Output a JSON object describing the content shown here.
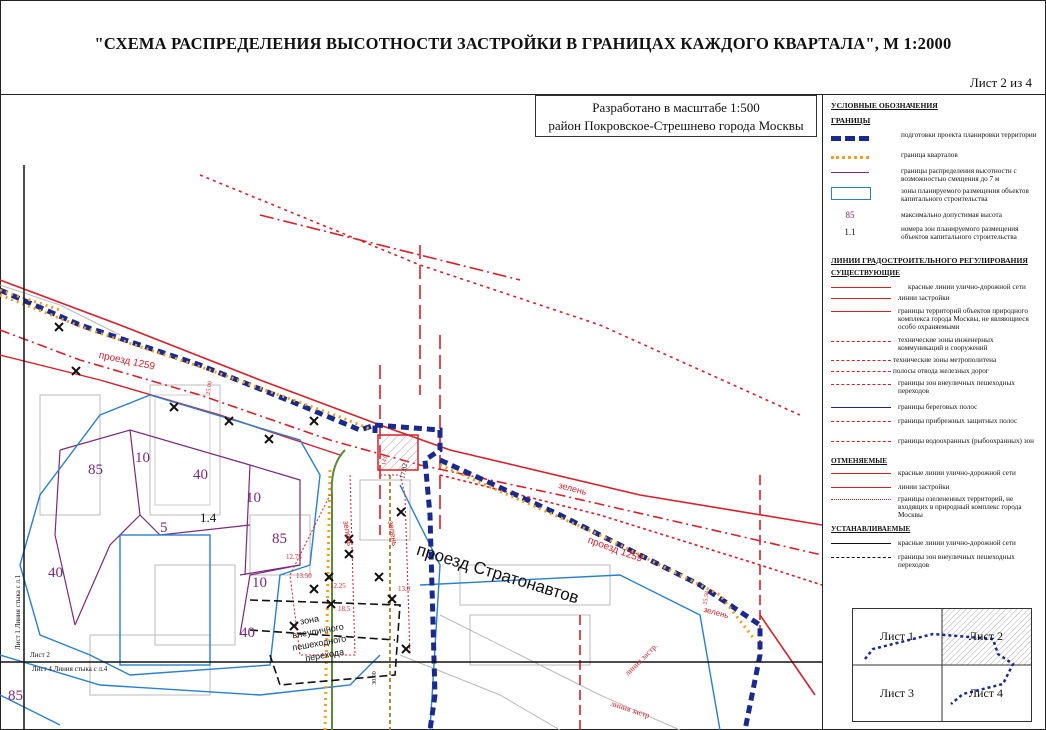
{
  "header": {
    "title": "\"СХЕМА РАСПРЕДЕЛЕНИЯ ВЫСОТНОСТИ ЗАСТРОЙКИ В ГРАНИЦАХ КАЖДОГО КВАРТАЛА\", М 1:2000",
    "sheet": "Лист 2 из 4"
  },
  "scale_box": {
    "line1": "Разработано в масштабе 1:500",
    "line2": "район Покровское-Стрешнево города Москвы"
  },
  "map": {
    "street_main": "проезд Стратонавтов",
    "street_1259_a": "проезд 1259",
    "street_1259_b": "проезд 1259",
    "zelen_a": "зелень",
    "zelen_b": "зелень",
    "zelen_c": "зелень",
    "zelen_d": "зелень",
    "zone_label_1": "зона",
    "zone_label_2": "внеуличного",
    "zone_label_3": "пешеходного",
    "zone_label_4": "перехода",
    "heights": [
      "85",
      "10",
      "40",
      "10",
      "5",
      "85",
      "40",
      "10",
      "40",
      "85"
    ],
    "zone_number": "1.4",
    "small_nums": [
      "25.00",
      "17.82",
      "14.0",
      "12.75",
      "13.50",
      "18.5",
      "12.25",
      "13.0",
      "30.00",
      "25.58"
    ],
    "stitch_1": "Лист 1  Линия стыка с л.1",
    "stitch_2": "Лист 2",
    "stitch_4": "Лист 4  Линия стыка с л.4",
    "liniya_zastr": "линия застр.",
    "liniya_zastr2": "линия застр"
  },
  "legend": {
    "title": "УСЛОВНЫЕ ОБОЗНАЧЕНИЯ",
    "boundaries": "ГРАНИЦЫ",
    "b1": "подготовки проекта планировки территории",
    "b2": "граница кварталов",
    "b3": "границы распределения высотности с возможностью смещения до 7 м",
    "b4": "зоны планируемого размещения объектов капитального строительства",
    "b5_sym": "85",
    "b5": "максимально допустимая высота",
    "b6_sym": "1.1",
    "b6": "номера зон планируемого размещения объектов капитального строительства",
    "lines_title": "ЛИНИИ ГРАДОСТРОИТЕЛЬНОГО РЕГУЛИРОВАНИЯ",
    "existing": "СУЩЕСТВУЮЩИЕ",
    "e1": "красные линии улично-дорожной сети",
    "e2": "линии застройки",
    "e3": "границы территорий объектов природного комплекса города Москвы, не являющиеся особо охраняемыми",
    "e4": "технические зоны инженерных коммуникаций и сооружений",
    "e5": "технические зоны метрополитена",
    "e6": "полосы отвода железных дорог",
    "e7": "границы зон внеуличных пешеходных переходов",
    "e8": "границы береговых полос",
    "e9": "границы прибрежных защитных полос",
    "e10": "границы водоохранных (рыбоохранных) зон",
    "cancelled": "ОТМЕНЯЕМЫЕ",
    "c1": "красные линии улично-дорожной сети",
    "c2": "линии застройки",
    "c3": "границы озелененных территорий, не входящих в природный комплекс города Москвы",
    "established": "УСТАНАВЛИВАЕМЫЕ",
    "s1": "красные линии улично-дорожной сети",
    "s2": "границы зон внеуличных пешеходных переходов"
  },
  "minimap": {
    "sheet1": "Лист 1",
    "sheet2": "Лист 2",
    "sheet3": "Лист 3",
    "sheet4": "Лист 4"
  },
  "colors": {
    "red_line": "#d8202a",
    "blue_zone": "#2a7fd0",
    "purple": "#7a2a7a",
    "navy_dash": "#1a2a8c",
    "orange_dot": "#f0a020",
    "green_line": "#5a8a3a"
  }
}
